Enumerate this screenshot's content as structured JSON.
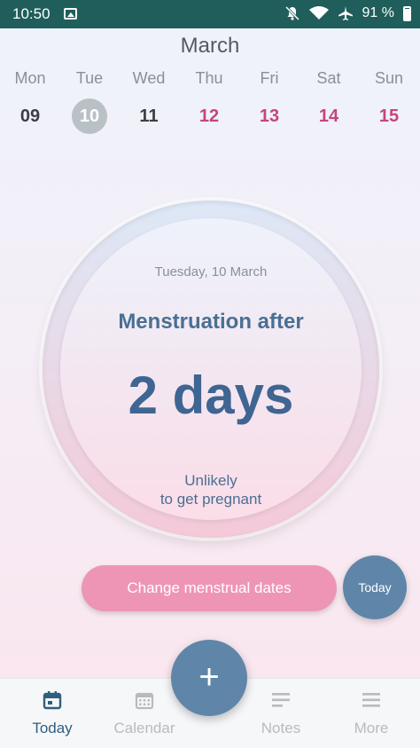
{
  "status_bar": {
    "time": "10:50",
    "battery_pct": "91 %"
  },
  "header": {
    "month": "March"
  },
  "week": [
    {
      "name": "Mon",
      "num": "09",
      "state": "normal"
    },
    {
      "name": "Tue",
      "num": "10",
      "state": "today"
    },
    {
      "name": "Wed",
      "num": "11",
      "state": "normal"
    },
    {
      "name": "Thu",
      "num": "12",
      "state": "period"
    },
    {
      "name": "Fri",
      "num": "13",
      "state": "period"
    },
    {
      "name": "Sat",
      "num": "14",
      "state": "period"
    },
    {
      "name": "Sun",
      "num": "15",
      "state": "period"
    }
  ],
  "circle": {
    "date": "Tuesday, 10 March",
    "title": "Menstruation after",
    "count": "2 days",
    "subtitle_line1": "Unlikely",
    "subtitle_line2": "to get pregnant"
  },
  "actions": {
    "change_dates": "Change menstrual dates",
    "today": "Today",
    "add": "+"
  },
  "nav": [
    {
      "label": "Today",
      "icon": "calendar-today-icon",
      "active": true
    },
    {
      "label": "Calendar",
      "icon": "calendar-grid-icon",
      "active": false
    },
    {
      "label": "Notes",
      "icon": "notes-icon",
      "active": false
    },
    {
      "label": "More",
      "icon": "menu-icon",
      "active": false
    }
  ],
  "colors": {
    "accent": "#5f86a8",
    "pink": "#ee95b5",
    "period_text": "#c4467a",
    "statusbar": "#1f5e5a"
  }
}
